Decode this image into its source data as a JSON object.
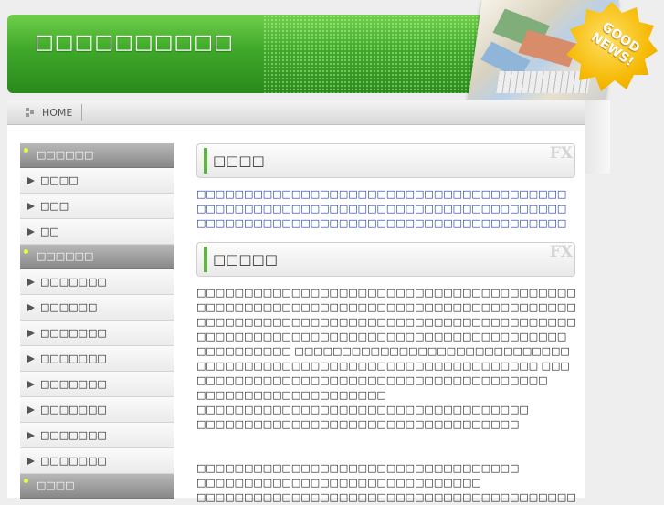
{
  "header": {
    "site_title": "□□□□□□□□□□",
    "badge_text": "GOOD NEWS!"
  },
  "nav": {
    "home_label": "HOME"
  },
  "sidebar": {
    "groups": [
      {
        "heading": "□□□□□□",
        "items": [
          "□□□□",
          "□□□",
          "□□"
        ]
      },
      {
        "heading": "□□□□□□",
        "items": [
          "□□□□□□□",
          "□□□□□□",
          "□□□□□□□",
          "□□□□□□□",
          "□□□□□□□",
          "□□□□□□□",
          "□□□□□□□",
          "□□□□□□□"
        ]
      },
      {
        "heading": "□□□□",
        "items": []
      }
    ]
  },
  "content": {
    "section1": {
      "title": "□□□□",
      "fx_mark": "FX",
      "text": "□□□□□□□□□□□□□□□□□□□□□□□□□□□□□□□□□□□□□□□□□□□□□□□□□□□□□□□□□□□□□□□□□□□□□□□□□□□□□□□□□□□□□□□□□□□□□□□□□□□□□□□□□□□□□□□□□□□□□□□□□□□□□□□□□□□□□□□□□□□□□□□□□"
    },
    "section2": {
      "title": "□□□□□",
      "fx_mark": "FX",
      "lines": [
        "□□□□□□□□□□□□□□□□□□□□□□□□□□□□□□□□□□□□□□□□□□□□□□□□□",
        "□□□□□□□□□□□□□□□□□□□□□□□□□□□□□□□□□□□□□□□□□□□□□",
        "□□□□□□□□□□□□□□□□□□□□□□□□□□□□□□□□□□□□□□□□□□□□□□□□□",
        "□□□□□□□□□□□□□□□□□□□□□□□□□□□□□□□□□□□□□□□□□□□□□□□□□ □□□□□□□□□□□□□□□□□□□□□□□□□□□□□□□□□□□□□□□□□□□□□□□□□□□□□□□□□□□□",
        "□□□□□□□□□□□□□□□□□□□□□□□□□□□□□□□□□□□□ □□□□□□□□□□□□□□□□□□□□□□□□□□□□□□□□□□□□□□□□",
        "□□□□□□□□□□□□□□□□□□□□",
        "□□□□□□□□□□□□□□□□□□□□□□□□□□□□□□□□□□□",
        "□□□□□□□□□□□□□□□□□□□□□□□□□□□□□□□□□□"
      ],
      "lines_after_gap": [
        "□□□□□□□□□□□□□□□□□□□□□□□□□□□□□□□□□□",
        "□□□□□□□□□□□□□□□□□□□□□□□□□□□□□□",
        "□□□□□□□□□□□□□□□□□□□□□□□□□□□□□□□□□□□□□□□□"
      ]
    }
  },
  "colors": {
    "accent_green": "#5cb83c",
    "link_blue": "#1a3aa0"
  }
}
